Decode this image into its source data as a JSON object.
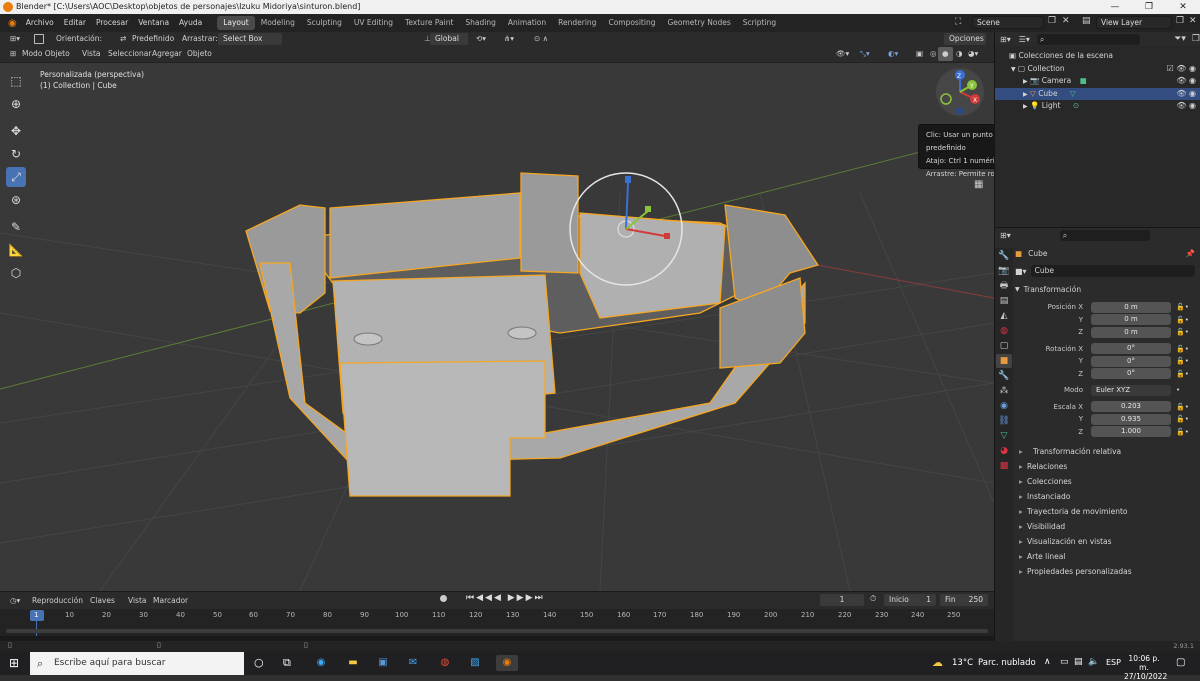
{
  "window": {
    "title": "Blender* [C:\\Users\\AOC\\Desktop\\objetos de personajes\\Izuku Midoriya\\sinturon.blend]",
    "controls": [
      "—",
      "❐",
      "✕"
    ]
  },
  "menu": {
    "items": [
      "Archivo",
      "Editar",
      "Procesar",
      "Ventana",
      "Ayuda"
    ],
    "workspaces": [
      "Layout",
      "Modeling",
      "Sculpting",
      "UV Editing",
      "Texture Paint",
      "Shading",
      "Animation",
      "Rendering",
      "Compositing",
      "Geometry Nodes",
      "Scripting"
    ],
    "active_workspace": "Layout",
    "scene": "Scene",
    "view_layer": "View Layer"
  },
  "header1": {
    "orientation_label": "Orientación:",
    "orientation_value": "Predefinido",
    "drag_label": "Arrastrar:",
    "drag_value": "Select Box",
    "transform_orientation": "Global",
    "options_label": "Opciones"
  },
  "header2": {
    "mode": "Modo Objeto",
    "items": [
      "Vista",
      "Seleccionar",
      "Agregar",
      "Objeto"
    ]
  },
  "viewport": {
    "view_name": "Personalizada (perspectiva)",
    "collection_info": "(1) Collection | Cube",
    "gizmo_axes": [
      "Z",
      "Y",
      "X"
    ]
  },
  "tooltip": {
    "line1": "Clic: Usar un punto de vista predefinido",
    "line2": "Atajo: Ctrl 1 numérico",
    "line3": "Arrastre: Permite rotar la vista"
  },
  "outliner": {
    "root": "Colecciones de la escena",
    "collection": "Collection",
    "items": [
      {
        "name": "Camera",
        "selected": false
      },
      {
        "name": "Cube",
        "selected": true
      },
      {
        "name": "Light",
        "selected": false
      }
    ]
  },
  "properties": {
    "object_name": "Cube",
    "data_name": "Cube",
    "section_transform": "Transformación",
    "pos_label": "Posición X",
    "rot_label": "Rotación X",
    "scale_label": "Escala X",
    "y_label": "Y",
    "z_label": "Z",
    "position": [
      "0 m",
      "0 m",
      "0 m"
    ],
    "rotation": [
      "0°",
      "0°",
      "0°"
    ],
    "mode_label": "Modo",
    "mode_value": "Euler XYZ",
    "scale": [
      "0.203",
      "0.935",
      "1.000"
    ],
    "sub_transform": "Transformación relativa",
    "panels": [
      "Relaciones",
      "Colecciones",
      "Instanciado",
      "Trayectoria de movimiento",
      "Visibilidad",
      "Visualización en vistas",
      "Arte lineal",
      "Propiedades personalizadas"
    ]
  },
  "timeline": {
    "menus": [
      "Reproducción",
      "Claves",
      "Vista",
      "Marcador"
    ],
    "current_frame": "1",
    "start_label": "Inicio",
    "start_value": "1",
    "end_label": "Fin",
    "end_value": "250",
    "ticks": [
      "1",
      "10",
      "20",
      "30",
      "40",
      "50",
      "60",
      "70",
      "80",
      "90",
      "100",
      "110",
      "120",
      "130",
      "140",
      "150",
      "160",
      "170",
      "180",
      "190",
      "200",
      "210",
      "220",
      "230",
      "240",
      "250"
    ]
  },
  "status": {
    "version": "2.93.1"
  },
  "taskbar": {
    "search_placeholder": "Escribe aquí para buscar",
    "weather_temp": "13°C",
    "weather_text": "Parc. nublado",
    "lang": "ESP",
    "time": "10:06 p. m.",
    "date": "27/10/2022"
  },
  "colors": {
    "selection_outline": "#f5a623",
    "active_blue": "#4772b3",
    "axis_x": "#d33a3a",
    "axis_y": "#8ac43a",
    "axis_z": "#3a6fd3"
  }
}
